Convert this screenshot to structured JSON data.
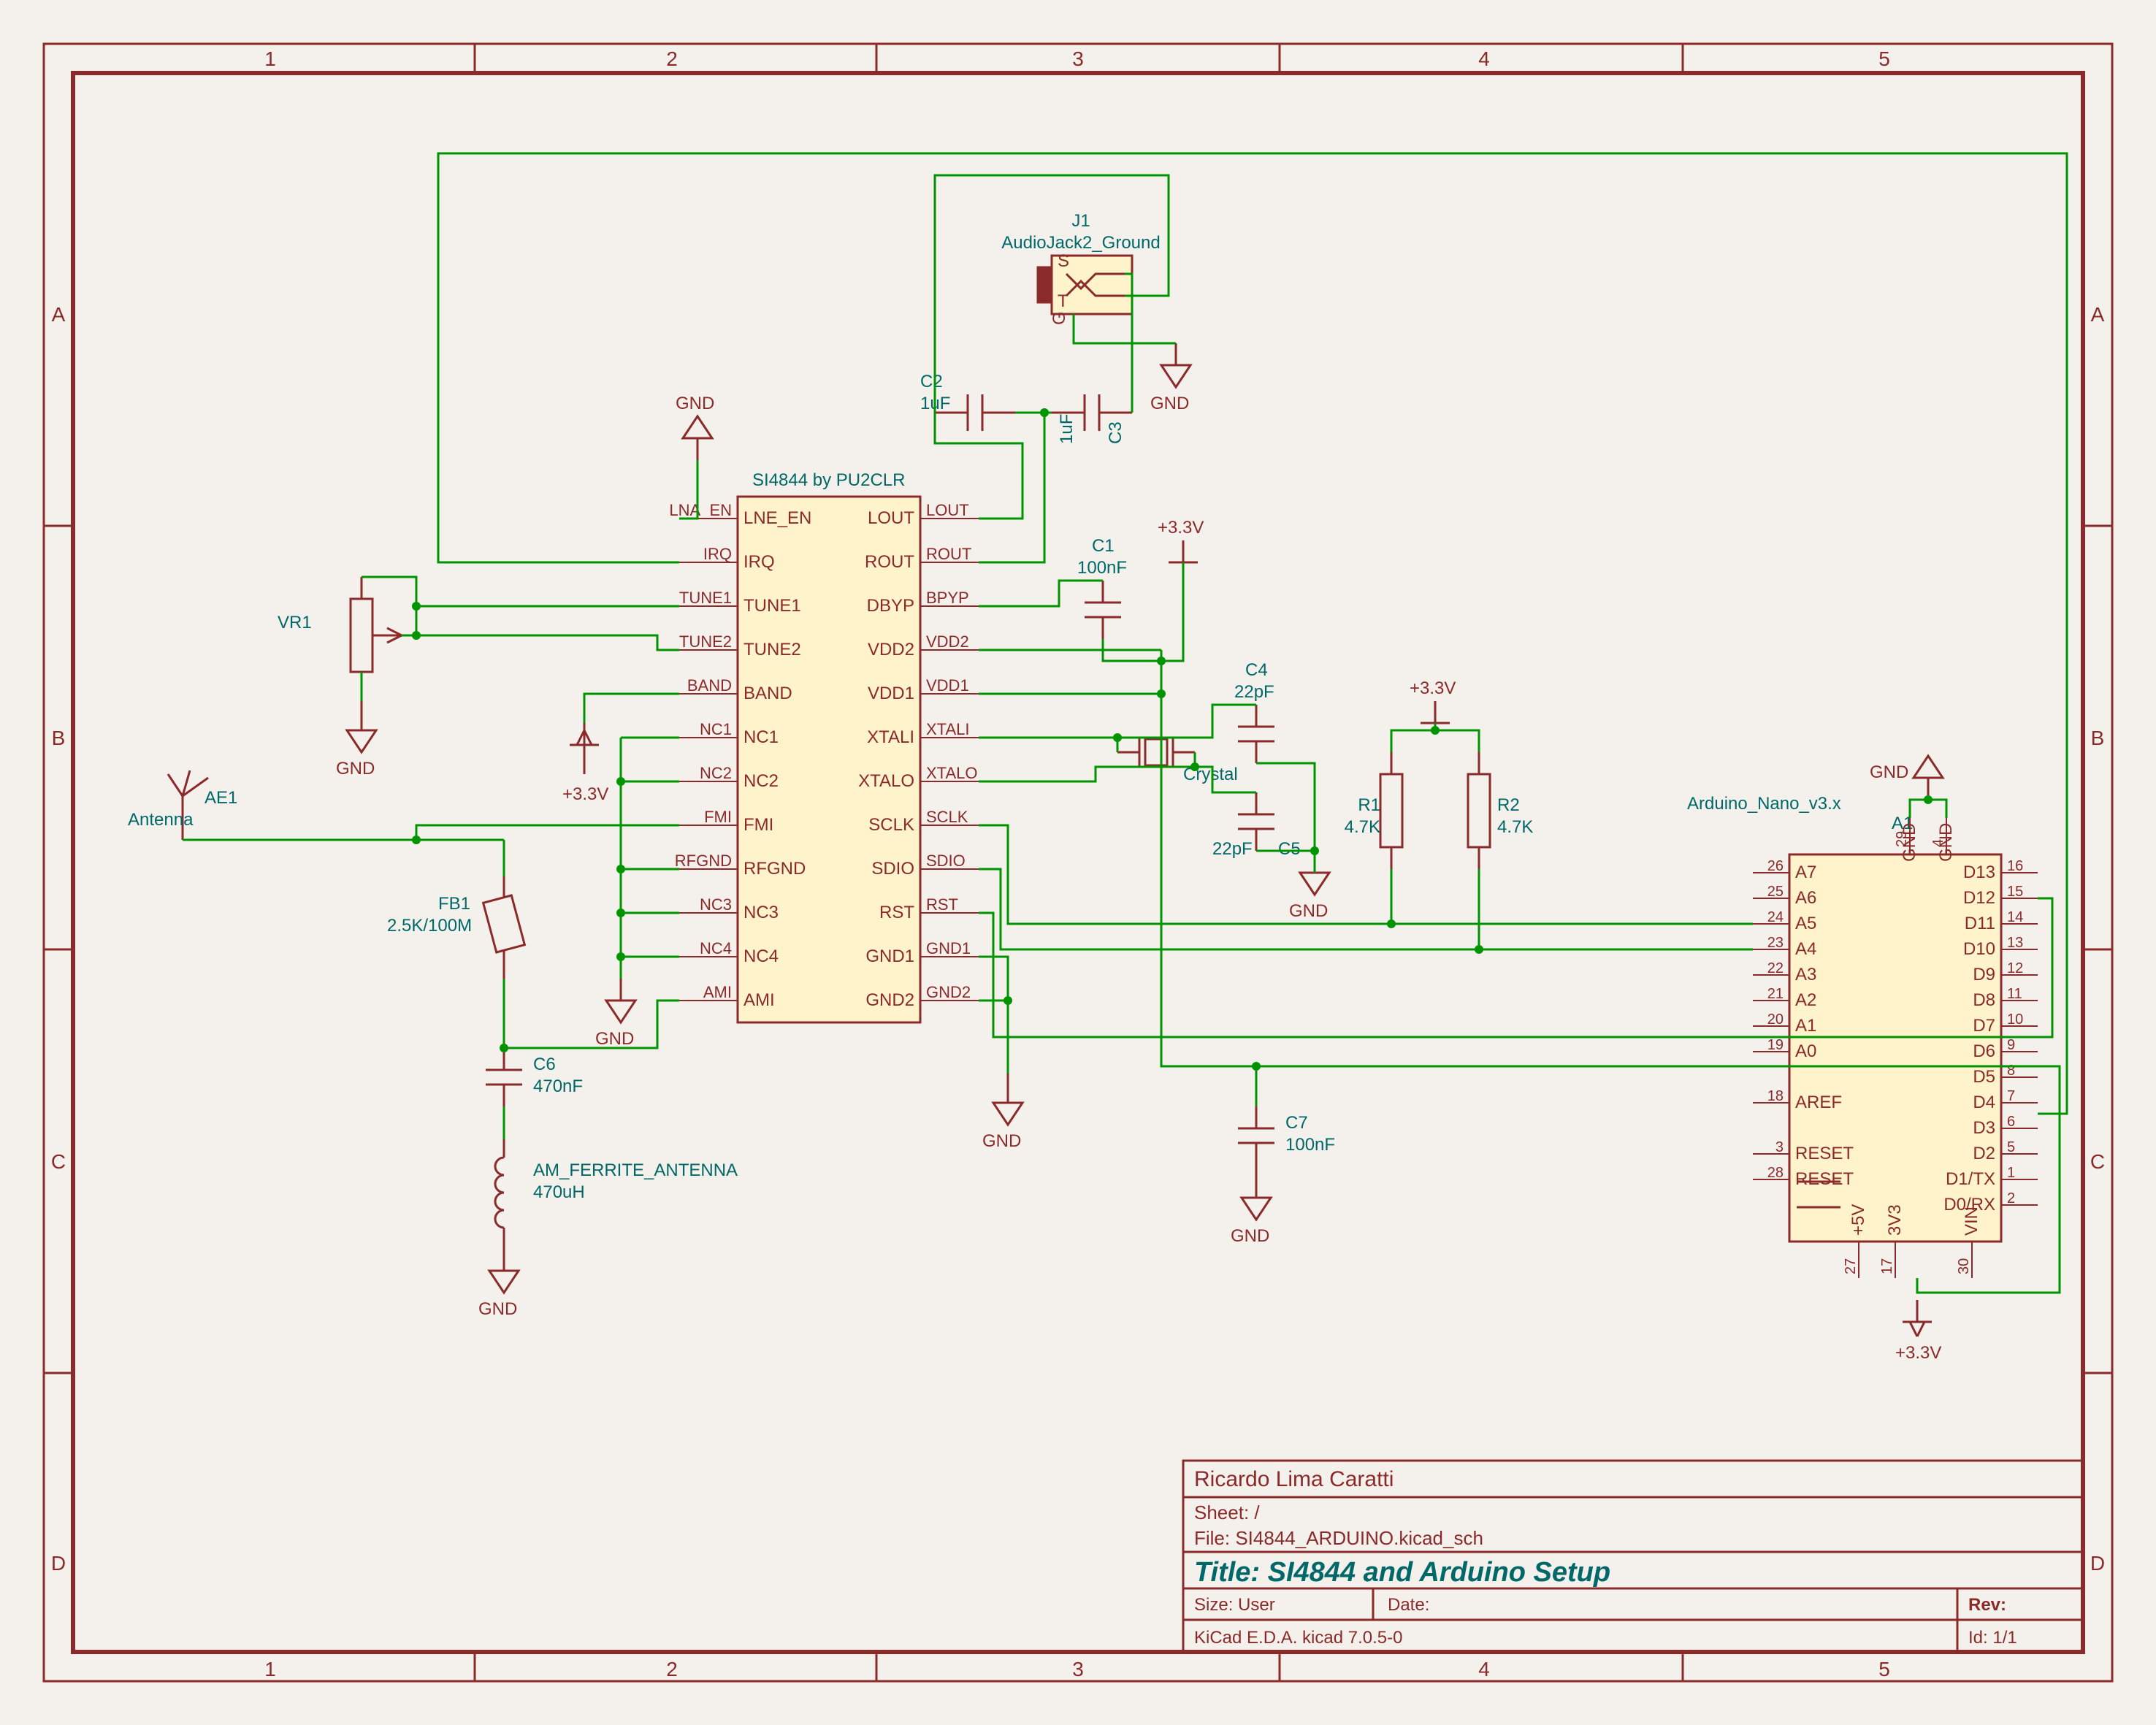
{
  "frame": {
    "cols_top": [
      "1",
      "2",
      "3",
      "4",
      "5"
    ],
    "cols_bot": [
      "1",
      "2",
      "3",
      "4",
      "5"
    ],
    "rows_left": [
      "A",
      "B",
      "C",
      "D"
    ],
    "rows_right": [
      "A",
      "B",
      "C",
      "D"
    ]
  },
  "titleblock": {
    "company": "Ricardo Lima Caratti",
    "sheet": "Sheet: /",
    "file": "File: SI4844_ARDUINO.kicad_sch",
    "title": "Title: SI4844 and Arduino Setup",
    "size": "Size: User",
    "date": "Date:",
    "rev": "Rev:",
    "generator": "KiCad E.D.A.  kicad 7.0.5-0",
    "id": "Id: 1/1"
  },
  "ic": {
    "ref": "SI4844 by PU2CLR",
    "left_pins": [
      "LNE_EN",
      "IRQ",
      "TUNE1",
      "TUNE2",
      "BAND",
      "NC1",
      "NC2",
      "FMI",
      "RFGND",
      "NC3",
      "NC4",
      "AMI"
    ],
    "left_labels": [
      "LNA_EN",
      "IRQ",
      "TUNE1",
      "TUNE2",
      "BAND",
      "NC1",
      "NC2",
      "FMI",
      "RFGND",
      "NC3",
      "NC4",
      "AMI"
    ],
    "right_pins": [
      "LOUT",
      "ROUT",
      "DBYP",
      "VDD2",
      "VDD1",
      "XTALI",
      "XTALO",
      "SCLK",
      "SDIO",
      "RST",
      "GND1",
      "GND2"
    ],
    "right_labels": [
      "LOUT",
      "ROUT",
      "BPYP",
      "VDD2",
      "VDD1",
      "XTALI",
      "XTALO",
      "SCLK",
      "SDIO",
      "RST",
      "GND1",
      "GND2"
    ]
  },
  "arduino": {
    "ref": "A1",
    "val": "Arduino_Nano_v3.x",
    "left_pins": [
      "A7",
      "A6",
      "A5",
      "A4",
      "A3",
      "A2",
      "A1",
      "A0",
      "",
      "AREF",
      "",
      "RESET",
      "RESET"
    ],
    "left_nums": [
      "26",
      "25",
      "24",
      "23",
      "22",
      "21",
      "20",
      "19",
      "",
      "18",
      "",
      "3",
      "28"
    ],
    "right_pins": [
      "D13",
      "D12",
      "D11",
      "D10",
      "D9",
      "D8",
      "D7",
      "D6",
      "D5",
      "D4",
      "D3",
      "D2",
      "D1/TX",
      "D0/RX"
    ],
    "right_nums": [
      "16",
      "15",
      "14",
      "13",
      "12",
      "11",
      "10",
      "9",
      "8",
      "7",
      "6",
      "5",
      "1",
      "2"
    ],
    "top_pins": [
      "GND",
      "GND"
    ],
    "top_nums": [
      "29",
      "4"
    ],
    "bot_pins": [
      "+5V",
      "3V3",
      "VIN"
    ],
    "bot_nums": [
      "27",
      "17",
      "30"
    ]
  },
  "parts": {
    "VR1": {
      "ref": "VR1"
    },
    "AE1": {
      "ref": "AE1",
      "val": "Antenna"
    },
    "FB1": {
      "ref": "FB1",
      "val": "2.5K/100M"
    },
    "C6": {
      "ref": "C6",
      "val": "470nF"
    },
    "AM_ANT": {
      "ref": "AM_FERRITE_ANTENNA",
      "val": "470uH"
    },
    "J1": {
      "ref": "J1",
      "val": "AudioJack2_Ground"
    },
    "C2": {
      "ref": "C2",
      "val": "1uF"
    },
    "C3": {
      "ref": "C3",
      "val2": "1uF"
    },
    "C1": {
      "ref": "C1",
      "val": "100nF"
    },
    "C4": {
      "ref": "C4",
      "val": "22pF"
    },
    "C5": {
      "ref": "C5",
      "val": "22pF"
    },
    "C7": {
      "ref": "C7",
      "val": "100nF"
    },
    "R1": {
      "ref": "R1",
      "val": "4.7K"
    },
    "R2": {
      "ref": "R2",
      "val": "4.7K"
    },
    "Crystal": {
      "ref": "Crystal"
    }
  },
  "pwr": {
    "GND": "GND",
    "V33": "+3.3V"
  },
  "colors": {
    "maroon": "#8a2a2a",
    "green": "#009400",
    "teal": "#006868",
    "fill": "#fff3cc"
  }
}
